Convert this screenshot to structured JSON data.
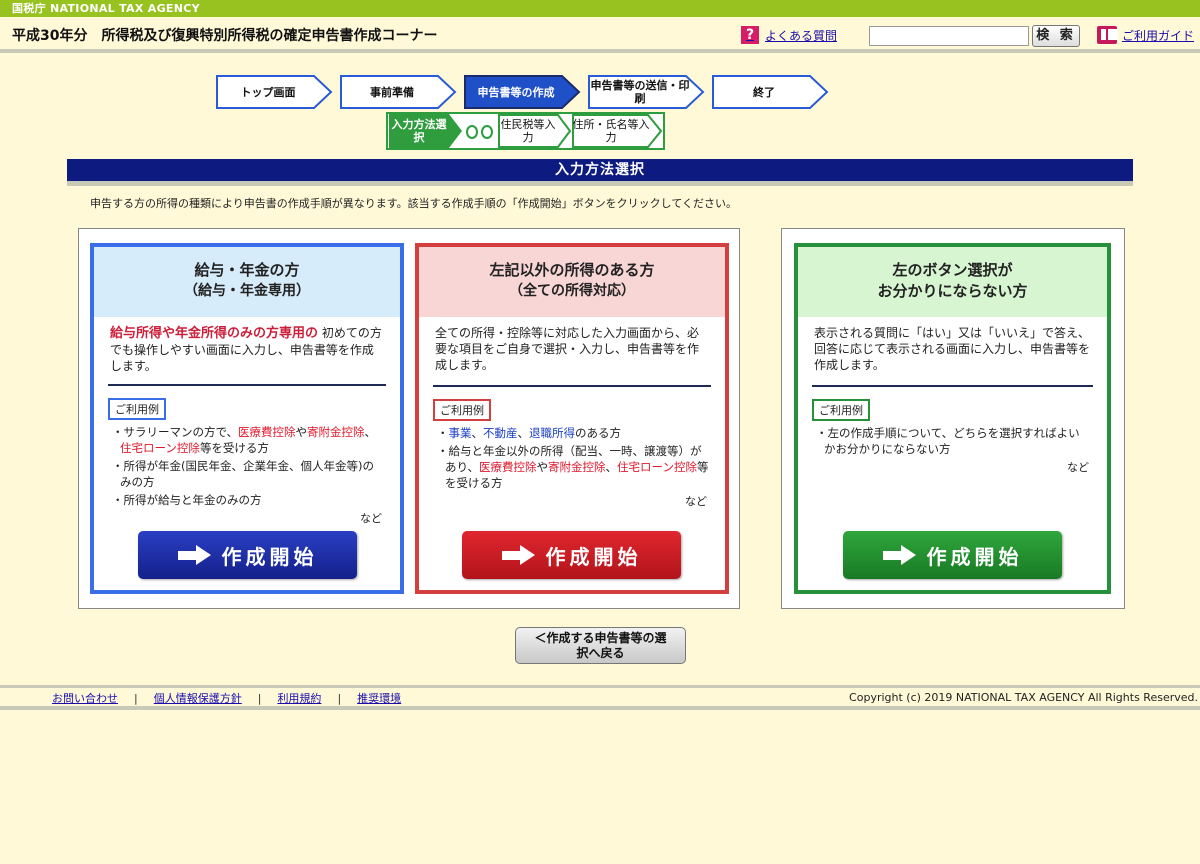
{
  "topbar": {
    "agency": "国税庁  NATIONAL TAX AGENCY"
  },
  "header": {
    "title": "平成30年分　所得税及び復興特別所得税の確定申告書作成コーナー",
    "faq_label": "よくある質問",
    "search_placeholder": "",
    "search_button": "検 索",
    "guide_label": "ご利用ガイド"
  },
  "steps": [
    {
      "label": "トップ画面",
      "active": false
    },
    {
      "label": "事前準備",
      "active": false
    },
    {
      "label": "申告書等の作成",
      "active": true
    },
    {
      "label": "申告書等の送信・印刷",
      "active": false
    },
    {
      "label": "終了",
      "active": false
    }
  ],
  "substeps": [
    {
      "label": "入力方法選択",
      "active": true
    },
    {
      "label": "住民税等入力",
      "active": false
    },
    {
      "label": "住所・氏名等入力",
      "active": false
    }
  ],
  "section_title": "入力方法選択",
  "intro": "申告する方の所得の種類により申告書の作成手順が異なります。該当する作成手順の「作成開始」ボタンをクリックしてください。",
  "cards": {
    "salary": {
      "title": "給与・年金の方",
      "subtitle": "（給与・年金専用）",
      "highlight": "給与所得や年金所得のみの方専用の",
      "desc": "初めての方でも操作しやすい画面に入力し、申告書等を作成します。",
      "tag": "ご利用例",
      "items": [
        {
          "pre": "サラリーマンの方で、",
          "r1": "医療費控除",
          "mid": "や",
          "r2": "寄附金控除",
          "mid2": "、",
          "r3": "住宅ローン控除",
          "post": "等を受ける方"
        },
        {
          "text": "所得が年金(国民年金、企業年金、個人年金等)のみの方"
        },
        {
          "text": "所得が給与と年金のみの方"
        }
      ],
      "nado": "など",
      "button": "作成開始",
      "color": "#3a6de8"
    },
    "other": {
      "title": "左記以外の所得のある方",
      "subtitle": "（全ての所得対応）",
      "desc": "全ての所得・控除等に対応した入力画面から、必要な項目をご自身で選択・入力し、申告書等を作成します。",
      "tag": "ご利用例",
      "items": [
        {
          "b1": "事業",
          "s1": "、",
          "b2": "不動産",
          "s2": "、",
          "b3": "退職所得",
          "post": "のある方"
        },
        {
          "pre": "給与と年金以外の所得（配当、一時、譲渡等）があり、",
          "r1": "医療費控除",
          "mid": "や",
          "r2": "寄附金控除",
          "mid2": "、",
          "r3": "住宅ローン控除",
          "post": "等を受ける方"
        }
      ],
      "nado": "など",
      "button": "作成開始",
      "color": "#d33f3f"
    },
    "unsure": {
      "title": "左のボタン選択が",
      "subtitle": "お分かりにならない方",
      "desc": "表示される質問に「はい」又は「いいえ」で答え、回答に応じて表示される画面に入力し、申告書等を作成します。",
      "tag": "ご利用例",
      "items": [
        {
          "text": "左の作成手順について、どちらを選択すればよいかお分かりにならない方"
        }
      ],
      "nado": "など",
      "button": "作成開始",
      "color": "#27903a"
    }
  },
  "back_button": "＜作成する申告書等の選択へ戻る",
  "footer": {
    "links": [
      "お問い合わせ",
      "個人情報保護方針",
      "利用規約",
      "推奨環境"
    ],
    "copyright": "Copyright (c) 2019 NATIONAL TAX AGENCY All Rights Reserved."
  }
}
